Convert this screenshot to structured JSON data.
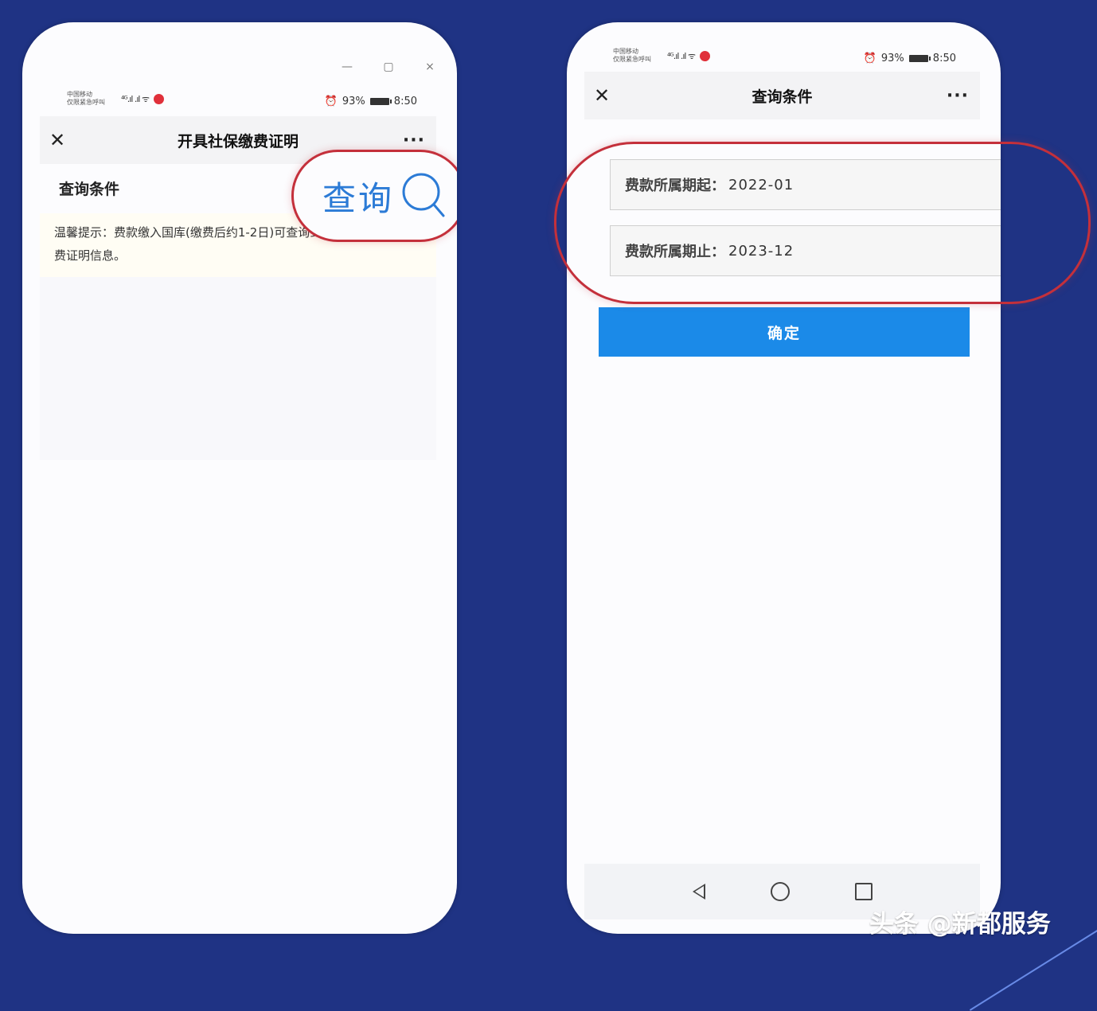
{
  "left_phone": {
    "window_controls": [
      "—",
      "▢",
      "×"
    ],
    "status": {
      "carrier_line1": "中国移动",
      "carrier_line2": "仅限紧急呼叫",
      "signal": "⁴ᴳ.ıl .ıl ᯤ",
      "alarm": "⏰",
      "battery": "93%",
      "time": "8:50"
    },
    "header": {
      "close": "✕",
      "title": "开具社保缴费证明",
      "more": "···"
    },
    "section_title": "查询条件",
    "hint": "温馨提示：费款缴入国库(缴费后约1-2日)可查询到缴费证明信息。",
    "callout_text": "查询"
  },
  "right_phone": {
    "status": {
      "carrier_line1": "中国移动",
      "carrier_line2": "仅限紧急呼叫",
      "signal": "⁴ᴳ.ıl .ıl ᯤ",
      "alarm": "⏰",
      "battery": "93%",
      "time": "8:50"
    },
    "header": {
      "close": "✕",
      "title": "查询条件",
      "more": "···"
    },
    "start_period": {
      "label": "费款所属期起：",
      "value": "2022-01"
    },
    "end_period": {
      "label": "费款所属期止：",
      "value": "2023-12"
    },
    "confirm_label": "确定"
  },
  "watermark": "头条 @新都服务",
  "colors": {
    "background": "#1f3384",
    "accent": "#1b8ae8",
    "highlight": "#c4303b",
    "callout_text": "#2c7bd6"
  }
}
